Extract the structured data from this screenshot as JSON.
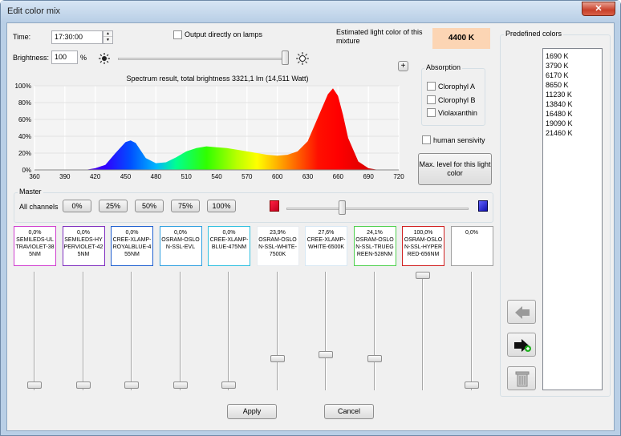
{
  "window": {
    "title": "Edit color mix",
    "close_glyph": "✕"
  },
  "time": {
    "label": "Time:",
    "value": "17:30:00",
    "up": "▲",
    "down": "▼"
  },
  "output_directly": {
    "label": "Output directly on lamps",
    "checked": false
  },
  "estimate": {
    "label": "Estimated light color of this mixture",
    "value": "4400 K",
    "color": "#fcd5b4"
  },
  "brightness": {
    "label": "Brightness:",
    "value": "100",
    "unit": "%",
    "level": 1.0
  },
  "plus_button": {
    "label": "+"
  },
  "absorption": {
    "title": "Absorption",
    "items": [
      {
        "label": "Clorophyl A",
        "checked": false
      },
      {
        "label": "Clorophyl B",
        "checked": false
      },
      {
        "label": "Violaxanthin",
        "checked": false
      }
    ]
  },
  "human": {
    "label": "human sensivity",
    "checked": false
  },
  "max_level": {
    "label": "Max. level for this light color"
  },
  "chart_data": {
    "type": "area",
    "title": "Spectrum result, total brightness 3321,1 lm (14,511 Watt)",
    "xlabel": "",
    "ylabel": "",
    "xlim": [
      360,
      720
    ],
    "ylim": [
      0,
      100
    ],
    "grid": true,
    "x_ticks": [
      "360",
      "390",
      "420",
      "450",
      "480",
      "510",
      "540",
      "570",
      "600",
      "630",
      "660",
      "690",
      "720"
    ],
    "y_ticks": [
      "0%",
      "20%",
      "40%",
      "60%",
      "80%",
      "100%"
    ],
    "x": [
      400,
      410,
      420,
      430,
      440,
      450,
      455,
      460,
      470,
      480,
      490,
      500,
      510,
      520,
      530,
      540,
      550,
      560,
      570,
      580,
      590,
      600,
      610,
      620,
      630,
      640,
      650,
      655,
      660,
      665,
      670,
      680,
      690,
      700
    ],
    "y": [
      0,
      0,
      2,
      6,
      20,
      33,
      35,
      32,
      14,
      8,
      9,
      15,
      22,
      26,
      28,
      27,
      26,
      24,
      22,
      20,
      18,
      17,
      18,
      22,
      34,
      62,
      90,
      97,
      88,
      65,
      38,
      10,
      2,
      0
    ]
  },
  "master": {
    "title": "Master",
    "all_channels_label": "All channels",
    "presets": [
      "0%",
      "25%",
      "50%",
      "75%",
      "100%"
    ],
    "level": 0.3
  },
  "channels": [
    {
      "pct": "0,0%",
      "name": "SEMILEDS-ULTRAVIOLET-385NM",
      "color": "#d040d0",
      "level": 0.0
    },
    {
      "pct": "0,0%",
      "name": "SEMILEDS-HYPERVIOLET-425NM",
      "color": "#8030c0",
      "level": 0.0
    },
    {
      "pct": "0,0%",
      "name": "CREE-XLAMP-ROYALBLUE-455NM",
      "color": "#2060d0",
      "level": 0.0
    },
    {
      "pct": "0,0%",
      "name": "OSRAM-OSLON-SSL-EVL",
      "color": "#30a0e0",
      "level": 0.0
    },
    {
      "pct": "0,0%",
      "name": "CREE-XLAMP-BLUE-475NM",
      "color": "#30c0e0",
      "level": 0.0
    },
    {
      "pct": "23,9%",
      "name": "OSRAM-OSLON-SSL-WHITE-7500K",
      "color": "#e8ecf0",
      "level": 0.239
    },
    {
      "pct": "27,6%",
      "name": "CREE-XLAMP-WHITE-6500K",
      "color": "#d8e8f4",
      "level": 0.276
    },
    {
      "pct": "24,1%",
      "name": "OSRAM-OSLON-SSL-TRUEGREEN-528NM",
      "color": "#50d050",
      "level": 0.241
    },
    {
      "pct": "100,0%",
      "name": "OSRAM-OSLON-SSL-HYPERRED-656NM",
      "color": "#d02020",
      "level": 1.0
    },
    {
      "pct": "0,0%",
      "name": "",
      "color": "#a0a0a0",
      "level": 0.0
    }
  ],
  "predefined": {
    "title": "Predefined colors",
    "items": [
      "1690 K",
      "3790 K",
      "6170 K",
      "8650 K",
      "11230 K",
      "13840 K",
      "16480 K",
      "19090 K",
      "21460 K"
    ]
  },
  "actions": {
    "apply": "Apply",
    "cancel": "Cancel"
  }
}
